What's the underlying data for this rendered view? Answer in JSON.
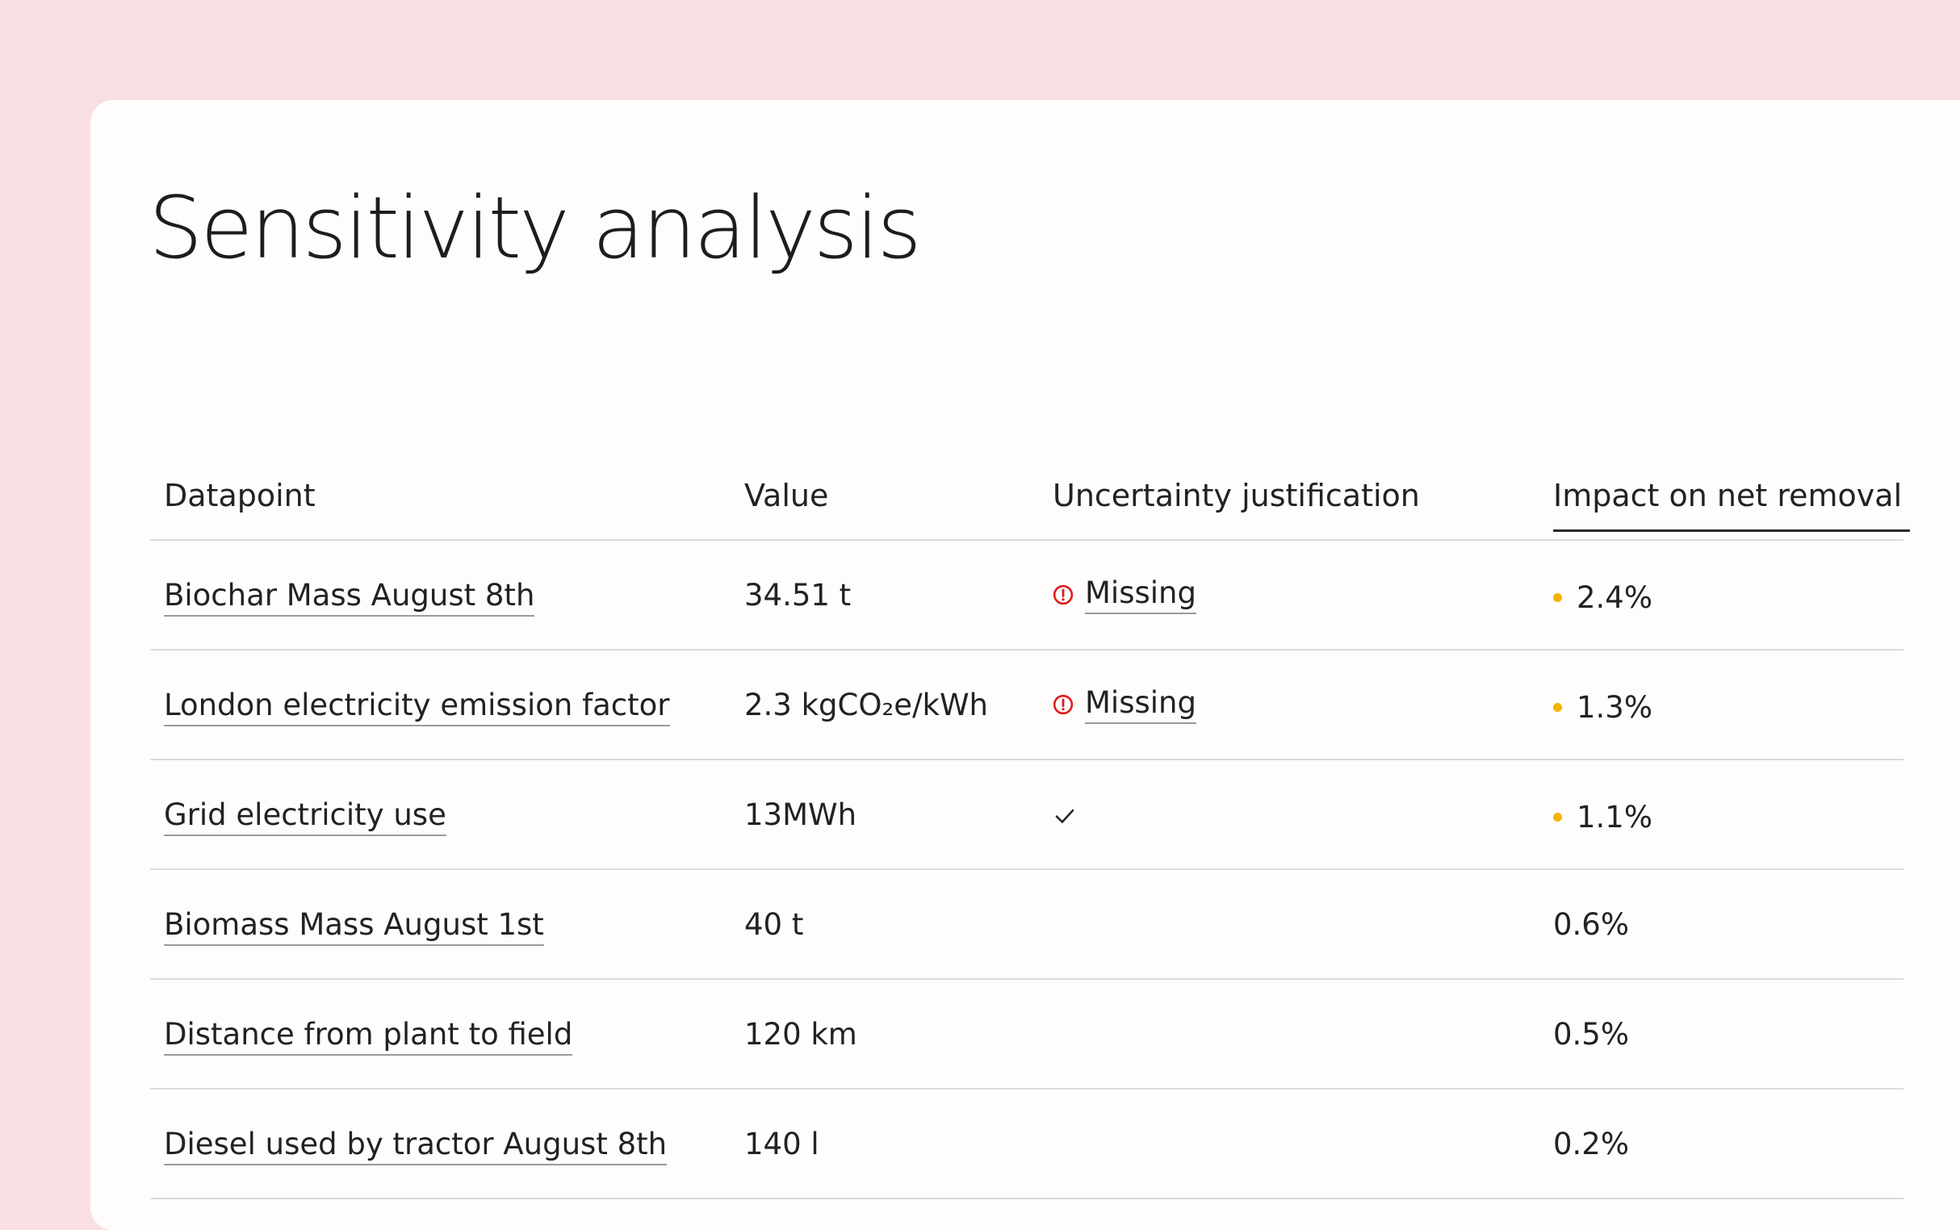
{
  "title": "Sensitivity analysis",
  "columns": {
    "datapoint": "Datapoint",
    "value": "Value",
    "uncertainty": "Uncertainty justification",
    "impact": "Impact on net removal"
  },
  "rows": [
    {
      "datapoint": "Biochar Mass August 8th",
      "value": "34.51 t",
      "uncertainty_status": "missing",
      "uncertainty_text": "Missing",
      "impact": "2.4%",
      "impact_flag": true
    },
    {
      "datapoint": "London electricity emission factor",
      "value": "2.3 kgCO₂e/kWh",
      "uncertainty_status": "missing",
      "uncertainty_text": "Missing",
      "impact": "1.3%",
      "impact_flag": true
    },
    {
      "datapoint": "Grid electricity use",
      "value": "13MWh",
      "uncertainty_status": "ok",
      "uncertainty_text": "",
      "impact": "1.1%",
      "impact_flag": true
    },
    {
      "datapoint": "Biomass Mass August 1st",
      "value": "40 t",
      "uncertainty_status": "none",
      "uncertainty_text": "",
      "impact": "0.6%",
      "impact_flag": false
    },
    {
      "datapoint": "Distance from plant to field",
      "value": "120 km",
      "uncertainty_status": "none",
      "uncertainty_text": "",
      "impact": "0.5%",
      "impact_flag": false
    },
    {
      "datapoint": "Diesel used by tractor August 8th",
      "value": "140 l",
      "uncertainty_status": "none",
      "uncertainty_text": "",
      "impact": "0.2%",
      "impact_flag": false
    }
  ],
  "icons": {
    "missing": "alert-circle-icon",
    "ok": "checkmark-icon",
    "impact_flag": "dot-indicator-icon"
  },
  "colors": {
    "page_background": "#fadfe2",
    "card_background": "#fffcfc",
    "missing_red": "#e01b1b",
    "impact_dot": "#f4b400",
    "divider": "#dddada"
  }
}
